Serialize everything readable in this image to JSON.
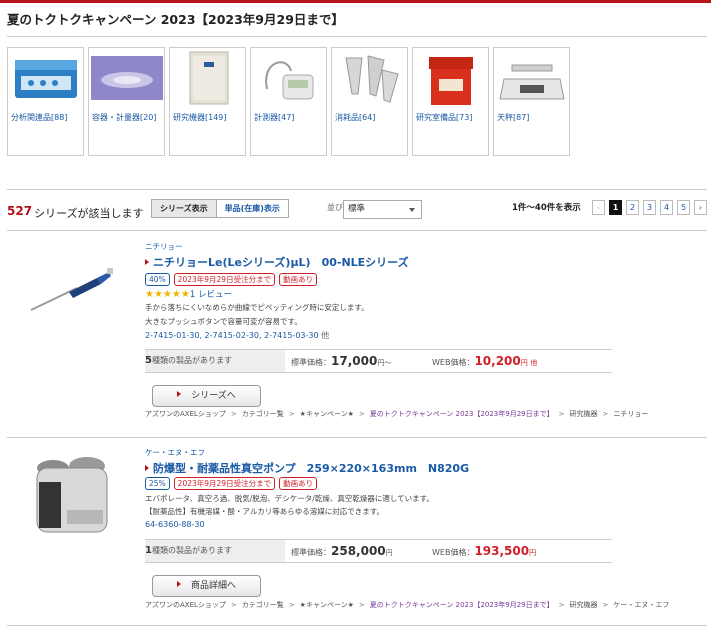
{
  "page_title": "夏のトクトクキャンペーン 2023【2023年9月29日まで】",
  "categories": [
    {
      "label": "分析関連品[88]",
      "icon": "analysis-kit-icon"
    },
    {
      "label": "容器・計量器[20]",
      "icon": "container-icon"
    },
    {
      "label": "研究機器[149]",
      "icon": "lab-equipment-icon"
    },
    {
      "label": "計測器[47]",
      "icon": "meter-icon"
    },
    {
      "label": "消耗品[64]",
      "icon": "tube-icon"
    },
    {
      "label": "研究室備品[73]",
      "icon": "sharps-container-icon"
    },
    {
      "label": "天秤[87]",
      "icon": "balance-icon"
    }
  ],
  "results": {
    "count": "527",
    "count_suffix": "シリーズが該当します",
    "view_series": "シリーズ表示",
    "view_single": "単品(在庫)表示",
    "sort_label": "並び替え：",
    "sort_value": "標準",
    "range": "1件～40件を表示",
    "pages": [
      "1",
      "2",
      "3",
      "4",
      "5"
    ],
    "prev": "‹",
    "next": "›"
  },
  "products": [
    {
      "maker": "ニチリョー",
      "name": "ニチリョーLe(Leシリーズ)μL)　00-NLEシリーズ",
      "badges": [
        "40%",
        "2023年9月29日受注分まで",
        "動画あり"
      ],
      "stars": "★★★★★",
      "review": "1 レビュー",
      "desc1": "手から落ちにくいなめらか曲線でピペッティング時に安定します。",
      "desc2": "大きなプッシュボタンで容量可変が容易です。",
      "codes": "2-7415-01-30, 2-7415-02-30, 2-7415-03-30",
      "codes_more": "他",
      "variants_num": "5",
      "variants_text": "種類の製品があります",
      "std_label": "標準価格：",
      "std_price": "17,000",
      "std_unit": "円～",
      "web_label": "WEB価格：",
      "web_price": "10,200",
      "web_unit": "円",
      "web_more": "他",
      "button": "シリーズへ",
      "crumbs": [
        "アズワンのAXELショップ",
        "カテゴリ一覧",
        "★キャンペーン★",
        "夏のトクトクキャンペーン 2023【2023年9月29日まで】",
        "研究機器",
        "ニチリョー"
      ]
    },
    {
      "maker": "ケー・エヌ・エフ",
      "name": "防爆型・耐薬品性真空ポンプ　259×220×163mm　N820G",
      "badges": [
        "25%",
        "2023年9月29日受注分まで",
        "動画あり"
      ],
      "desc1": "エバポレータ、真空ろ過、脱気/脱泡、デシケータ/乾燥、真空乾燥器に適しています。",
      "desc2": "【耐薬品性】有機溶媒・酸・アルカリ等あらゆる溶媒に対応できます。",
      "codes": "64-6360-88-30",
      "variants_num": "1",
      "variants_text": "種類の製品があります",
      "std_label": "標準価格：",
      "std_price": "258,000",
      "std_unit": "円",
      "web_label": "WEB価格：",
      "web_price": "193,500",
      "web_unit": "円",
      "button": "商品詳細へ",
      "crumbs": [
        "アズワンのAXELショップ",
        "カテゴリ一覧",
        "★キャンペーン★",
        "夏のトクトクキャンペーン 2023【2023年9月29日まで】",
        "研究機器",
        "ケー・エヌ・エフ"
      ]
    }
  ]
}
